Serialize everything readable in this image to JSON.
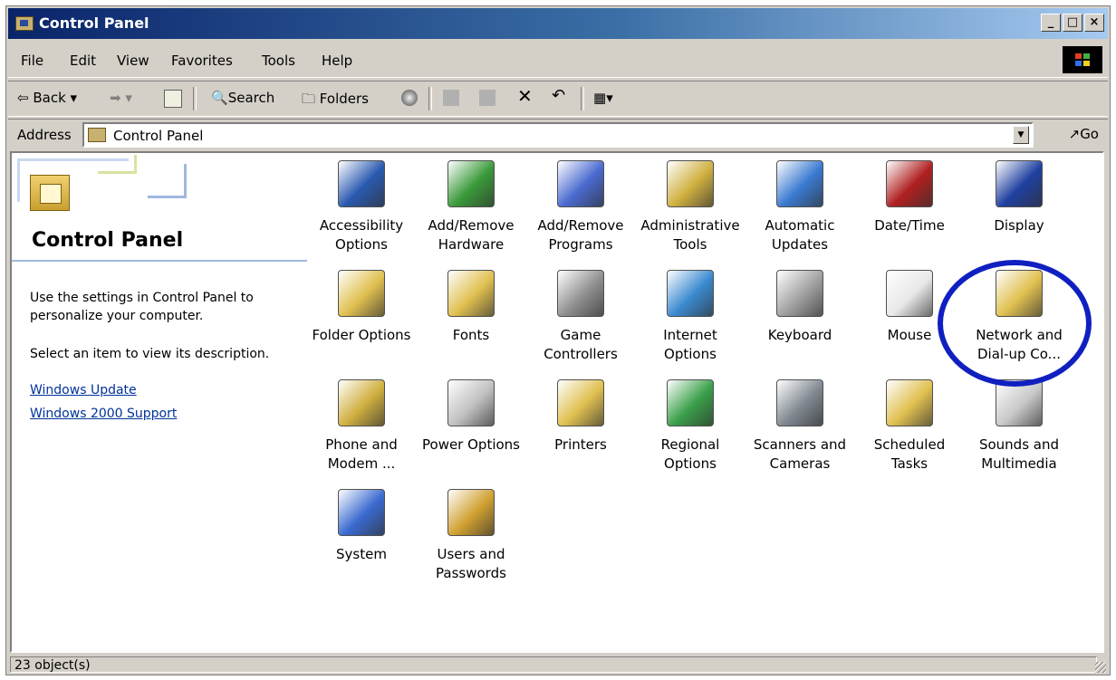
{
  "window": {
    "title": "Control Panel"
  },
  "title_buttons": [
    "_",
    "□",
    "×"
  ],
  "menu": [
    "File",
    "Edit",
    "View",
    "Favorites",
    "Tools",
    "Help"
  ],
  "toolbar": {
    "back": "Back",
    "search": "Search",
    "folders": "Folders"
  },
  "address": {
    "label": "Address",
    "value": "Control Panel",
    "go": "Go"
  },
  "left_pane": {
    "heading": "Control Panel",
    "description": "Use the settings in Control Panel to personalize your computer.",
    "hint": "Select an item to view its description.",
    "links": [
      "Windows Update",
      "Windows 2000 Support"
    ]
  },
  "items": [
    {
      "line1": "Accessibility",
      "line2": "Options",
      "icon": "accessibility-icon",
      "color": "#2a5ab0"
    },
    {
      "line1": "Add/Remove",
      "line2": "Hardware",
      "icon": "hardware-icon",
      "color": "#3a9a3a"
    },
    {
      "line1": "Add/Remove",
      "line2": "Programs",
      "icon": "programs-icon",
      "color": "#4a6ad0"
    },
    {
      "line1": "Administrative",
      "line2": "Tools",
      "icon": "admin-tools-icon",
      "color": "#d0b040"
    },
    {
      "line1": "Automatic",
      "line2": "Updates",
      "icon": "windows-flag-icon",
      "color": "#3a7ad0"
    },
    {
      "line1": "Date/Time",
      "line2": "",
      "icon": "calendar-clock-icon",
      "color": "#b02020"
    },
    {
      "line1": "Display",
      "line2": "",
      "icon": "display-icon",
      "color": "#2040a0"
    },
    {
      "line1": "Folder Options",
      "line2": "",
      "icon": "folder-options-icon",
      "color": "#e0c050"
    },
    {
      "line1": "Fonts",
      "line2": "",
      "icon": "fonts-icon",
      "color": "#e0c050"
    },
    {
      "line1": "Game",
      "line2": "Controllers",
      "icon": "joystick-icon",
      "color": "#909090"
    },
    {
      "line1": "Internet",
      "line2": "Options",
      "icon": "internet-globe-icon",
      "color": "#3a8ad0"
    },
    {
      "line1": "Keyboard",
      "line2": "",
      "icon": "keyboard-icon",
      "color": "#a0a0a0"
    },
    {
      "line1": "Mouse",
      "line2": "",
      "icon": "mouse-icon",
      "color": "#e8e8e8"
    },
    {
      "line1": "Network and",
      "line2": "Dial-up Co...",
      "icon": "network-folder-icon",
      "color": "#e0c050"
    },
    {
      "line1": "Phone and",
      "line2": "Modem ...",
      "icon": "phone-icon",
      "color": "#d0b040"
    },
    {
      "line1": "Power Options",
      "line2": "",
      "icon": "power-plug-icon",
      "color": "#c0c0c0"
    },
    {
      "line1": "Printers",
      "line2": "",
      "icon": "printer-folder-icon",
      "color": "#e0c050"
    },
    {
      "line1": "Regional",
      "line2": "Options",
      "icon": "globe-icon",
      "color": "#3aa04a"
    },
    {
      "line1": "Scanners and",
      "line2": "Cameras",
      "icon": "scanner-icon",
      "color": "#808890"
    },
    {
      "line1": "Scheduled",
      "line2": "Tasks",
      "icon": "scheduled-tasks-icon",
      "color": "#e0c050"
    },
    {
      "line1": "Sounds and",
      "line2": "Multimedia",
      "icon": "speaker-icon",
      "color": "#c8c8c8"
    },
    {
      "line1": "System",
      "line2": "",
      "icon": "computer-icon",
      "color": "#3a6ad0"
    },
    {
      "line1": "Users and",
      "line2": "Passwords",
      "icon": "users-key-icon",
      "color": "#d0a030"
    }
  ],
  "status": {
    "text": "23 object(s)"
  }
}
